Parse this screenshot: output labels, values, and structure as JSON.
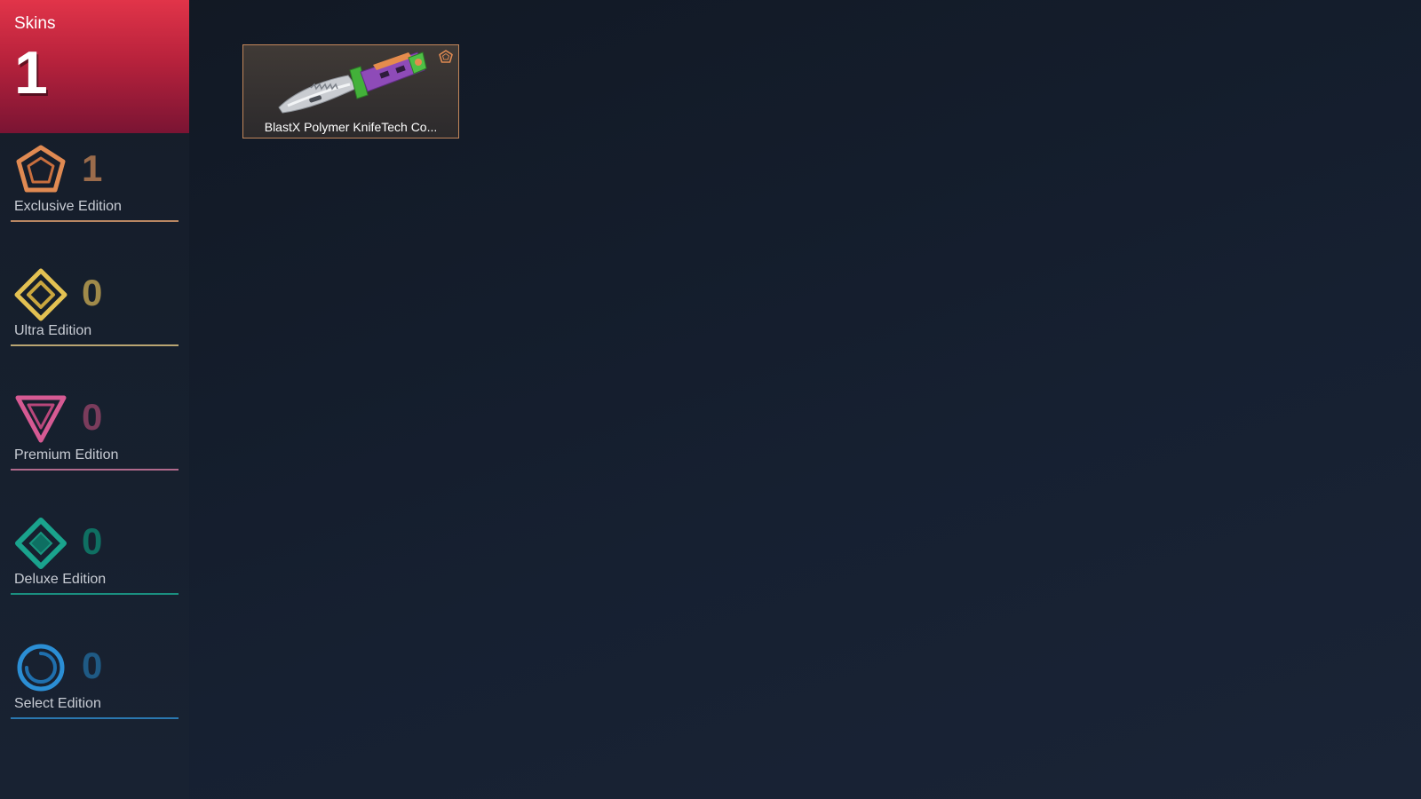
{
  "header": {
    "label": "Skins",
    "count": "1"
  },
  "editions": [
    {
      "label": "Exclusive Edition",
      "count": "1",
      "icon": "exclusive-edition-icon",
      "color": "#e08a52"
    },
    {
      "label": "Ultra Edition",
      "count": "0",
      "icon": "ultra-edition-icon",
      "color": "#e3c152"
    },
    {
      "label": "Premium Edition",
      "count": "0",
      "icon": "premium-edition-icon",
      "color": "#d65a93"
    },
    {
      "label": "Deluxe Edition",
      "count": "0",
      "icon": "deluxe-edition-icon",
      "color": "#1aa38d"
    },
    {
      "label": "Select Edition",
      "count": "0",
      "icon": "select-edition-icon",
      "color": "#2b8ed4"
    }
  ],
  "skins": [
    {
      "name": "BlastX Polymer KnifeTech Co...",
      "rarity_icon": "exclusive-edition-icon",
      "border_color": "#c3875a"
    }
  ]
}
